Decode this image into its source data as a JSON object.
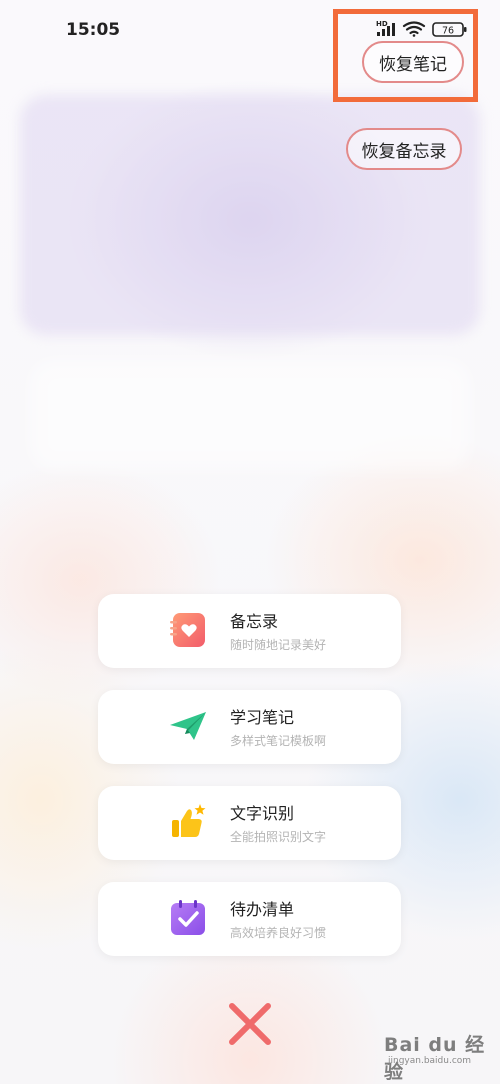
{
  "status_bar": {
    "time": "15:05",
    "network": "HD",
    "battery": "76"
  },
  "top_buttons": {
    "restore_notes": "恢复笔记",
    "restore_memo": "恢复备忘录"
  },
  "menu": [
    {
      "title": "备忘录",
      "subtitle": "随时随地记录美好",
      "icon": "heart-notebook-icon"
    },
    {
      "title": "学习笔记",
      "subtitle": "多样式笔记模板啊",
      "icon": "paper-plane-icon"
    },
    {
      "title": "文字识别",
      "subtitle": "全能拍照识别文字",
      "icon": "thumbs-up-icon"
    },
    {
      "title": "待办清单",
      "subtitle": "高效培养良好习惯",
      "icon": "checklist-calendar-icon"
    }
  ],
  "watermark": {
    "text": "Bai du 经验",
    "sub": "jingyan.baidu.com"
  },
  "colors": {
    "highlight": "#f26b3a",
    "pill_border": "#e38a8a",
    "close": "#ef6b6b"
  }
}
